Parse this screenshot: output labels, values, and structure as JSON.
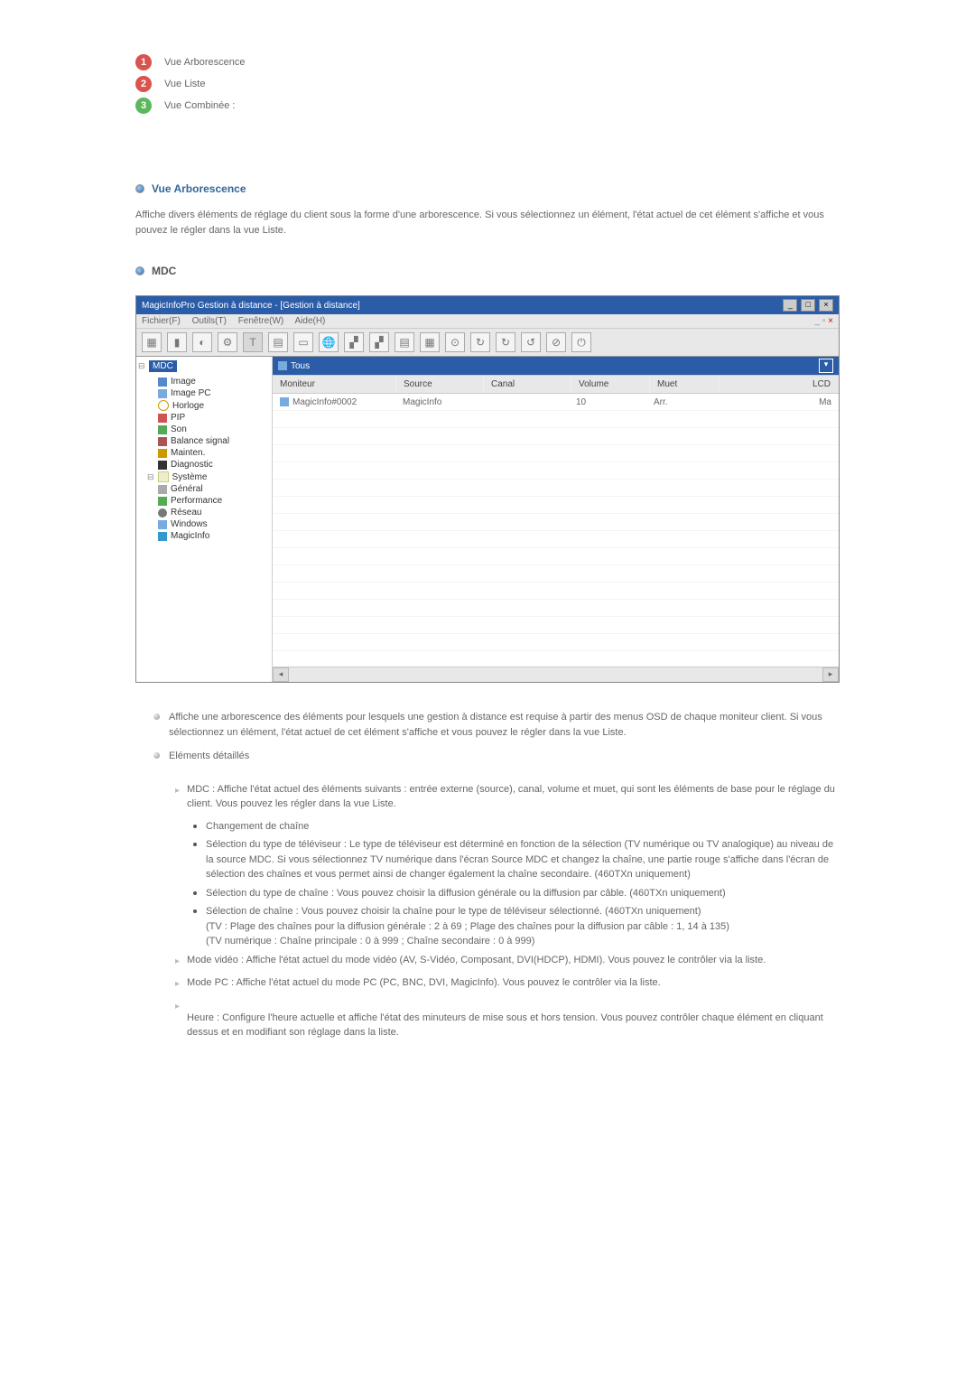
{
  "legend": {
    "item1": "Vue Arborescence",
    "item2": "Vue Liste",
    "item3": "Vue Combinée :"
  },
  "section1": {
    "title": "Vue Arborescence",
    "desc": "Affiche divers éléments de réglage du client sous la forme d'une arborescence. Si vous sélectionnez un élément, l'état actuel de cet élément s'affiche et vous pouvez le régler dans la vue Liste."
  },
  "mdc": {
    "heading": "MDC"
  },
  "app": {
    "title": "MagicInfoPro Gestion à distance - [Gestion à distance]",
    "menu": {
      "file": "Fichier(F)",
      "tools": "Outils(T)",
      "window": "Fenêtre(W)",
      "help": "Aide(H)"
    },
    "toolbar_icons": [
      "T"
    ],
    "tree": {
      "root": "MDC",
      "image": "Image",
      "imagepc": "Image PC",
      "horloge": "Horloge",
      "pip": "PIP",
      "son": "Son",
      "balance": "Balance signal",
      "mainten": "Mainten.",
      "diagnostic": "Diagnostic",
      "systeme": "Système",
      "general": "Général",
      "performance": "Performance",
      "reseau": "Réseau",
      "windows": "Windows",
      "magicinfo": "MagicInfo"
    },
    "list": {
      "filter": "Tous",
      "col_moniteur": "Moniteur",
      "col_source": "Source",
      "col_canal": "Canal",
      "col_volume": "Volume",
      "col_muet": "Muet",
      "col_lcd": "LCD",
      "row1_name": "MagicInfo#0002",
      "row1_source": "MagicInfo",
      "row1_canal": "",
      "row1_volume": "10",
      "row1_muet": "Arr.",
      "row1_lcd": "Ma"
    }
  },
  "content": {
    "para1": "Affiche une arborescence des éléments pour lesquels une gestion à distance est requise à partir des menus OSD de chaque moniteur client. Si vous sélectionnez un élément, l'état actuel de cet élément s'affiche et vous pouvez le régler dans la vue Liste.",
    "subhead": "Eléments détaillés",
    "mdc": "MDC : Affiche l'état actuel des éléments suivants : entrée externe (source), canal, volume et muet, qui sont les éléments de base pour le réglage du client. Vous pouvez les régler dans la vue Liste.",
    "dot_chgt": "Changement de chaîne",
    "dot_tvtype": "Sélection du type de téléviseur : Le type de téléviseur est déterminé en fonction de la sélection (TV numérique ou TV analogique) au niveau de la source MDC. Si vous sélectionnez TV numérique dans l'écran Source MDC et changez la chaîne, une partie rouge s'affiche dans l'écran de sélection des chaînes et vous permet ainsi de changer également la chaîne secondaire. (460TXn uniquement)",
    "dot_chtype": "Sélection du type de chaîne : Vous pouvez choisir la diffusion générale ou la diffusion par câble. (460TXn uniquement)",
    "dot_chsel": "Sélection de chaîne : Vous pouvez choisir la chaîne pour le type de téléviseur sélectionné. (460TXn uniquement)",
    "dot_chsel_tv": "(TV : Plage des chaînes pour la diffusion générale : 2 à 69 ; Plage des chaînes pour la diffusion par câble : 1, 14 à 135)",
    "dot_chsel_num": "(TV numérique : Chaîne principale : 0 à 999 ; Chaîne secondaire : 0 à 999)",
    "mode_video": "Mode vidéo : Affiche l'état actuel du mode vidéo (AV, S-Vidéo, Composant, DVI(HDCP), HDMI). Vous pouvez le contrôler via la liste.",
    "mode_pc": "Mode PC : Affiche l'état actuel du mode PC (PC, BNC, DVI, MagicInfo). Vous pouvez le contrôler via la liste.",
    "heure": "Heure : Configure l'heure actuelle et affiche l'état des minuteurs de mise sous et hors tension. Vous pouvez contrôler chaque élément en cliquant dessus et en modifiant son réglage dans la liste."
  }
}
